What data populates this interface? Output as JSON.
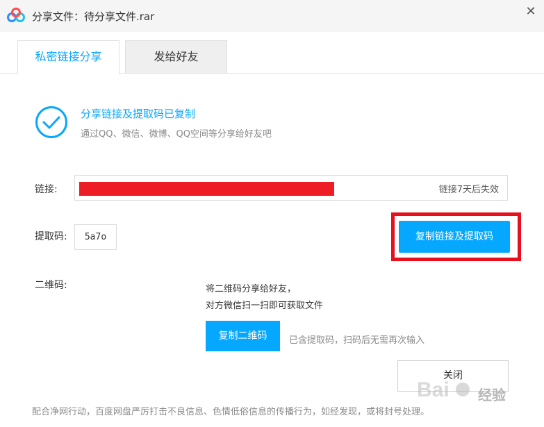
{
  "window": {
    "title": "分享文件：待分享文件.rar",
    "close_glyph": "✕"
  },
  "tabs": [
    {
      "label": "私密链接分享",
      "active": true
    },
    {
      "label": "发给好友",
      "active": false
    }
  ],
  "status": {
    "title": "分享链接及提取码已复制",
    "subtitle": "通过QQ、微信、微博、QQ空间等分享给好友吧"
  },
  "link": {
    "label": "链接:",
    "expiry": "链接7天后失效"
  },
  "code": {
    "label": "提取码:",
    "value": "5a7o",
    "copy_button": "复制链接及提取码"
  },
  "qr": {
    "label": "二维码:",
    "line1": "将二维码分享给好友，",
    "line2": "对方微信扫一扫即可获取文件",
    "copy_button": "复制二维码",
    "note": "已含提取码，扫码后无需再次输入"
  },
  "actions": {
    "close": "关闭"
  },
  "footer": "配合净网行动，百度网盘严厉打击不良信息、色情低俗信息的传播行为，如经发现，或将封号处理。",
  "watermark": "经验",
  "colors": {
    "accent": "#06a7ff",
    "highlight": "#e8101c",
    "redaction": "#ee1c24"
  }
}
